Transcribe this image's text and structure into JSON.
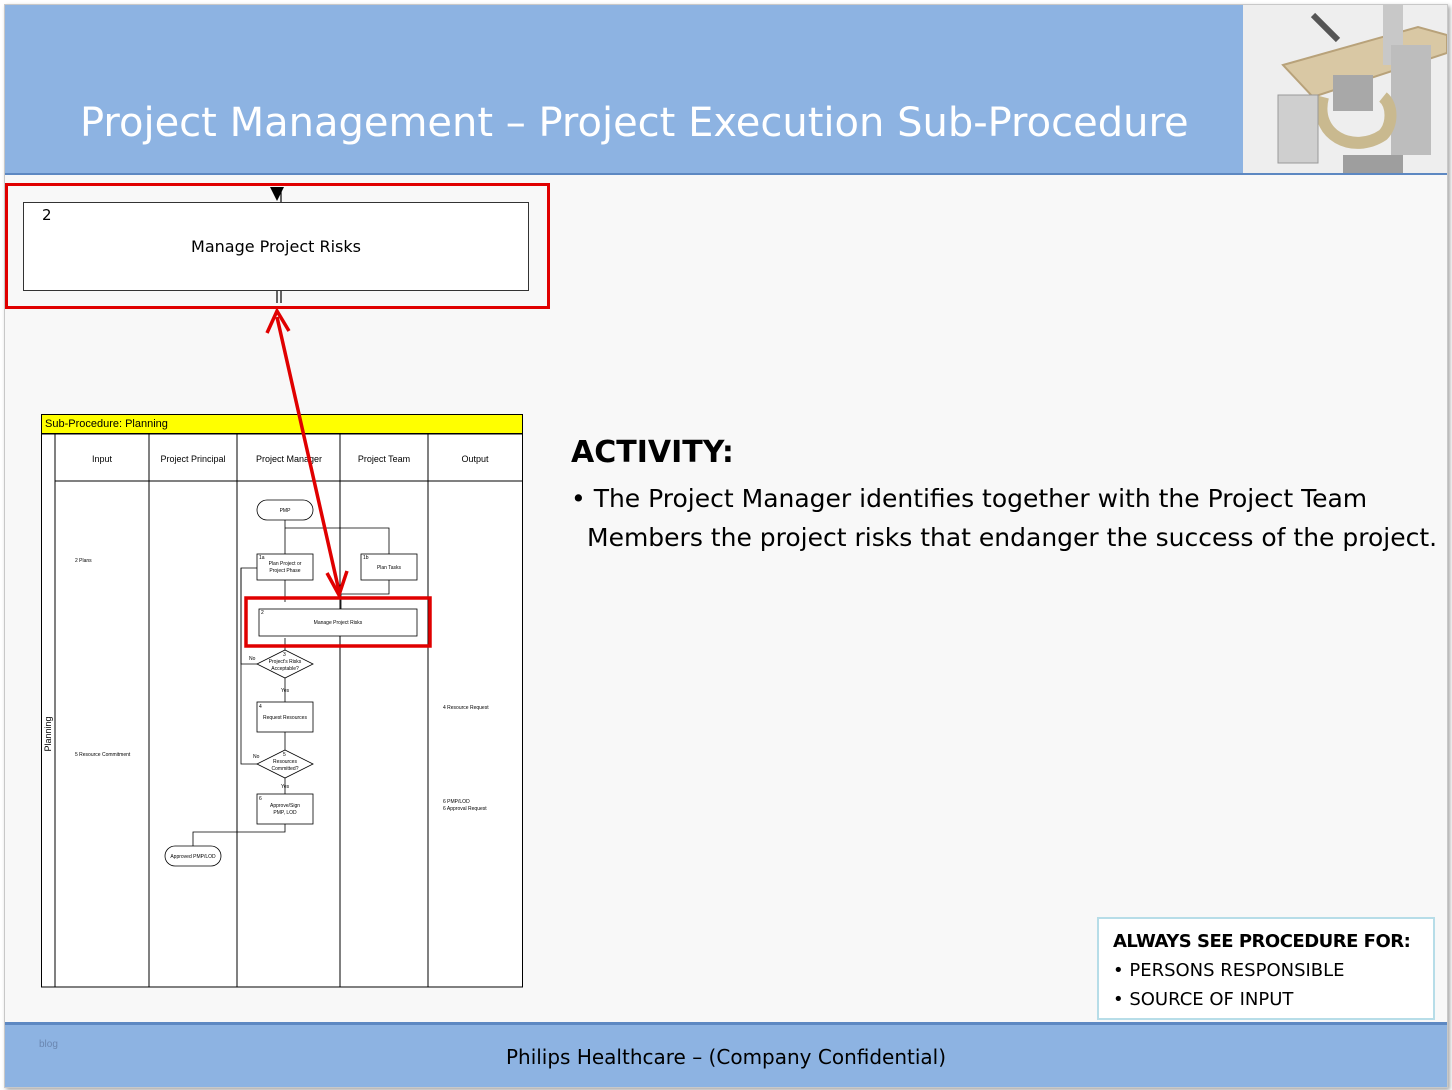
{
  "header": {
    "title": "Project Management – Project Execution Sub-Procedure"
  },
  "step": {
    "number": "2",
    "label": "Manage Project Risks"
  },
  "diagram": {
    "title": "Sub-Procedure: Planning",
    "lane_label": "Planning",
    "columns": [
      "Input",
      "Project Principal",
      "Project Manager",
      "Project Team",
      "Output"
    ],
    "nodes": {
      "start": "PMP",
      "plan_project_num": "1a",
      "plan_project": [
        "Plan Project or",
        "Project Phase"
      ],
      "plan_tasks_num": "1b",
      "plan_tasks": "Plan Tasks",
      "manage_risks_num": "2",
      "manage_risks": "Manage Project Risks",
      "decision_risks_num": "3",
      "decision_risks": [
        "Project's  Risks",
        "Acceptable?"
      ],
      "request_resources_num": "4",
      "request_resources": "Request Resources",
      "decision_resources_num": "5",
      "decision_resources": [
        "Resources",
        "Committed?"
      ],
      "approve_num": "6",
      "approve": [
        "Approve/Sign",
        "PMP, LOD"
      ],
      "end": "Approved PMP/LOD",
      "no": "No",
      "yes": "Yes"
    },
    "inputs": [
      "2 Plans",
      "5 Resource Commitment"
    ],
    "outputs": [
      "4 Resource Request",
      "6 PMP/LOD",
      "6 Approval Request"
    ]
  },
  "activity": {
    "heading": "ACTIVITY:",
    "bullet": "• The Project Manager identifies together with the Project Team Members the project risks that endanger the success of the project."
  },
  "procedure_box": {
    "heading": "ALWAYS SEE PROCEDURE FOR:",
    "items": [
      "• PERSONS RESPONSIBLE",
      "• SOURCE OF INPUT"
    ]
  },
  "footer": {
    "text": "Philips Healthcare – (Company Confidential)",
    "small": "blog"
  },
  "colors": {
    "header_bg": "#8db3e2",
    "highlight": "#e00000",
    "diagram_title_bg": "#ffff00"
  }
}
